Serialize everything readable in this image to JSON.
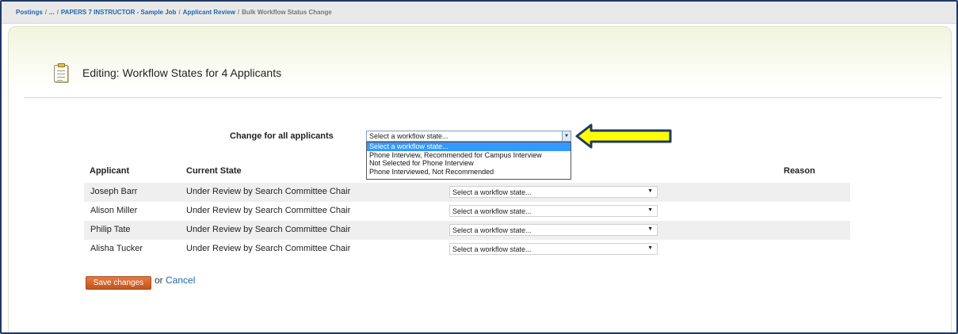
{
  "breadcrumb": {
    "root": "Postings",
    "ellipsis": "...",
    "posting": "PAPERS 7 INSTRUCTOR - Sample Job",
    "review": "Applicant Review",
    "current": "Bulk Workflow Status Change"
  },
  "page": {
    "title": "Editing: Workflow States for 4 Applicants"
  },
  "change_all": {
    "label": "Change for all applicants",
    "selected_value": "Select a workflow state...",
    "options": [
      "Select a workflow state...",
      "Phone Interview, Recommended for Campus Interview",
      "Not Selected for Phone Interview",
      "Phone Interviewed, Not Recommended"
    ]
  },
  "table": {
    "headers": {
      "applicant": "Applicant",
      "current_state": "Current State",
      "reason": "Reason"
    },
    "rows": [
      {
        "name": "Joseph Barr",
        "state": "Under Review by Search Committee Chair",
        "select": "Select a workflow state..."
      },
      {
        "name": "Alison Miller",
        "state": "Under Review by Search Committee Chair",
        "select": "Select a workflow state..."
      },
      {
        "name": "Philip Tate",
        "state": "Under Review by Search Committee Chair",
        "select": "Select a workflow state..."
      },
      {
        "name": "Alisha Tucker",
        "state": "Under Review by Search Committee Chair",
        "select": "Select a workflow state..."
      }
    ]
  },
  "actions": {
    "save_label": "Save changes",
    "or_text": "or",
    "cancel_label": "Cancel"
  },
  "colors": {
    "frame_border": "#1f3864",
    "link": "#2266aa",
    "save_button": "#d4622b",
    "arrow_fill": "#ffff00",
    "arrow_outline": "#1f3864",
    "dropdown_highlight": "#3399ff"
  },
  "icons": {
    "page_icon": "notepad-icon",
    "annotation": "arrow-left-icon"
  }
}
